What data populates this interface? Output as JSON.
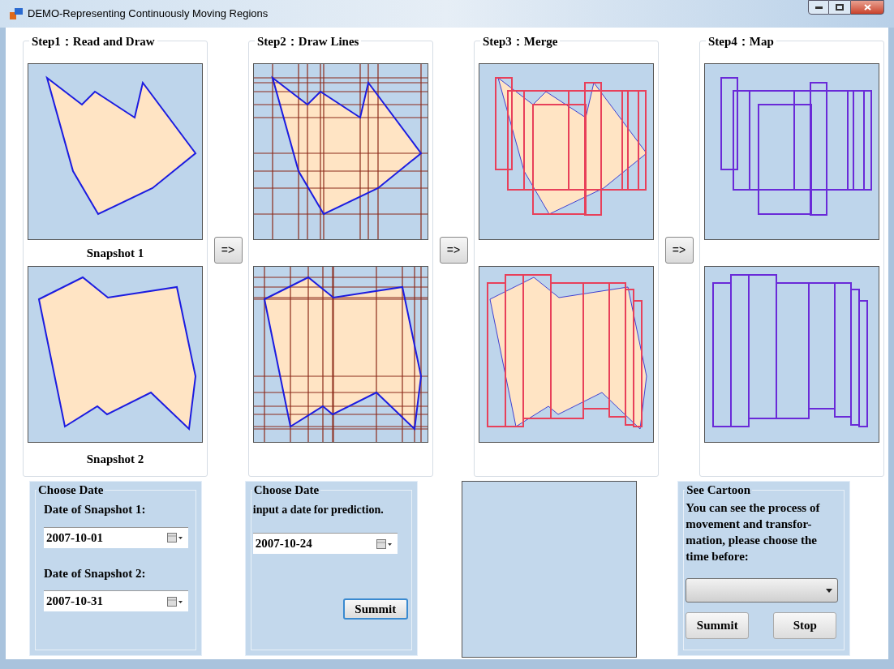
{
  "window": {
    "title": "DEMO-Representing Continuously Moving Regions"
  },
  "steps": [
    {
      "title": "Step1：Read and Draw",
      "kind": "polygon",
      "labels": [
        "Snapshot 1",
        "Snapshot 2"
      ]
    },
    {
      "title": "Step2：Draw Lines",
      "kind": "grid"
    },
    {
      "title": "Step3：Merge",
      "kind": "merge"
    },
    {
      "title": "Step4：Map",
      "kind": "map"
    }
  ],
  "arrow_buttons": [
    "=>",
    "=>",
    "=>"
  ],
  "panels": [
    {
      "kind": "dates",
      "title": "Choose Date",
      "fields": [
        {
          "label": "Date of Snapshot 1:",
          "value": "2007-10-01"
        },
        {
          "label": "Date of Snapshot 2:",
          "value": "2007-10-31"
        }
      ]
    },
    {
      "kind": "predict",
      "title": "Choose Date",
      "text": "input a date for prediction.",
      "value": "2007-10-24",
      "button": "Summit"
    },
    {
      "kind": "empty"
    },
    {
      "kind": "cartoon",
      "title": "See Cartoon",
      "text": "You can see the process of movement and transfor- mation, please choose the time before:",
      "buttons": [
        "Summit",
        "Stop"
      ]
    }
  ]
}
